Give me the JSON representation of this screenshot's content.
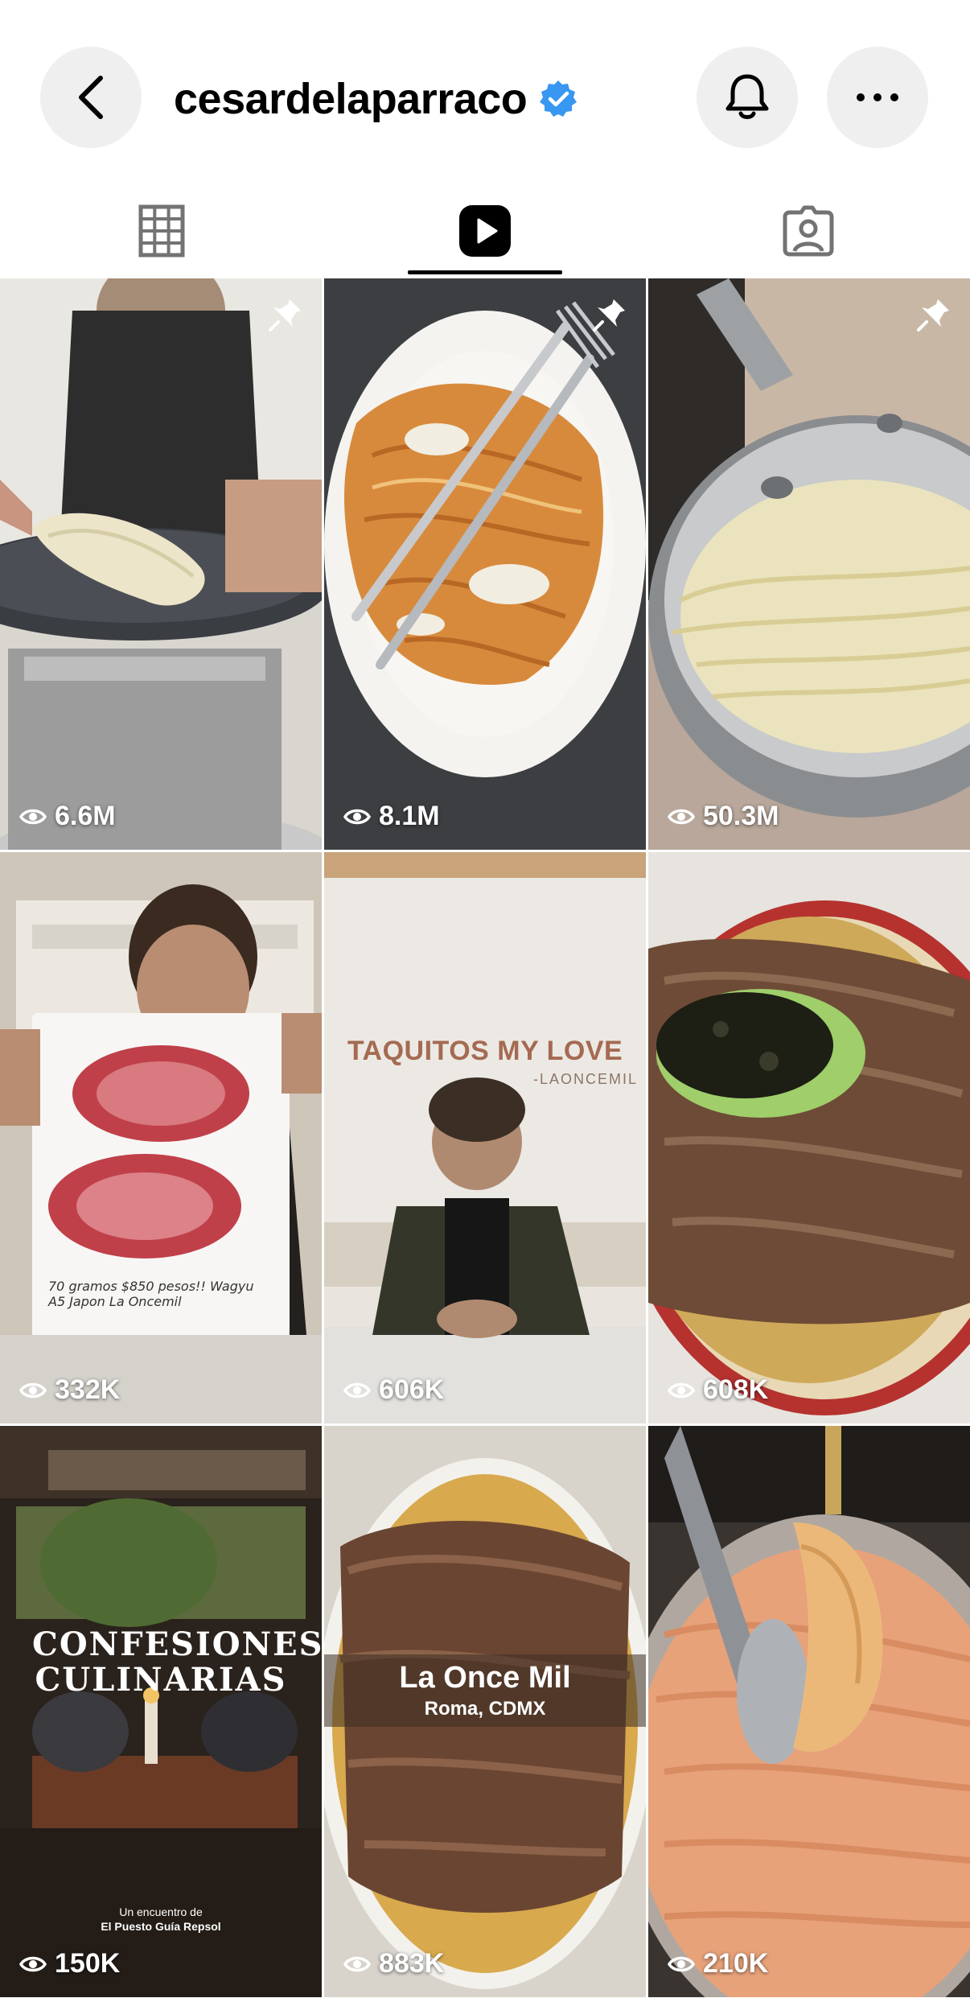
{
  "header": {
    "username": "cesardelaparraco",
    "verified": true,
    "icons": {
      "back": "chevron-left-icon",
      "bell": "bell-icon",
      "more": "ellipsis-icon"
    }
  },
  "tabs": [
    {
      "name": "grid",
      "icon": "grid-icon",
      "active": false
    },
    {
      "name": "reels",
      "icon": "reels-icon",
      "active": true
    },
    {
      "name": "tagged",
      "icon": "tagged-icon",
      "active": false
    }
  ],
  "reels": [
    {
      "views": "6.6M",
      "pinned": true
    },
    {
      "views": "8.1M",
      "pinned": true
    },
    {
      "views": "50.3M",
      "pinned": true
    },
    {
      "views": "332K",
      "pinned": false,
      "overlay": "70 gramos $850 pesos!! Wagyu A5 Japon La Oncemil"
    },
    {
      "views": "606K",
      "pinned": false,
      "overlay_title": "TAQUITOS MY LOVE",
      "overlay_sub": "-LAONCEMIL"
    },
    {
      "views": "608K",
      "pinned": false
    },
    {
      "views": "150K",
      "pinned": false,
      "overlay_title": "CONFESIONES CULINARIAS",
      "overlay_line1": "Un encuentro de",
      "overlay_line2": "El Puesto Guía Repsol"
    },
    {
      "views": "883K",
      "pinned": false,
      "overlay_title": "La Once Mil",
      "overlay_sub": "Roma, CDMX"
    },
    {
      "views": "210K",
      "pinned": false
    }
  ],
  "colors": {
    "verified": "#3897f0",
    "active_tab": "#000000",
    "inactive_tab": "#737373"
  }
}
